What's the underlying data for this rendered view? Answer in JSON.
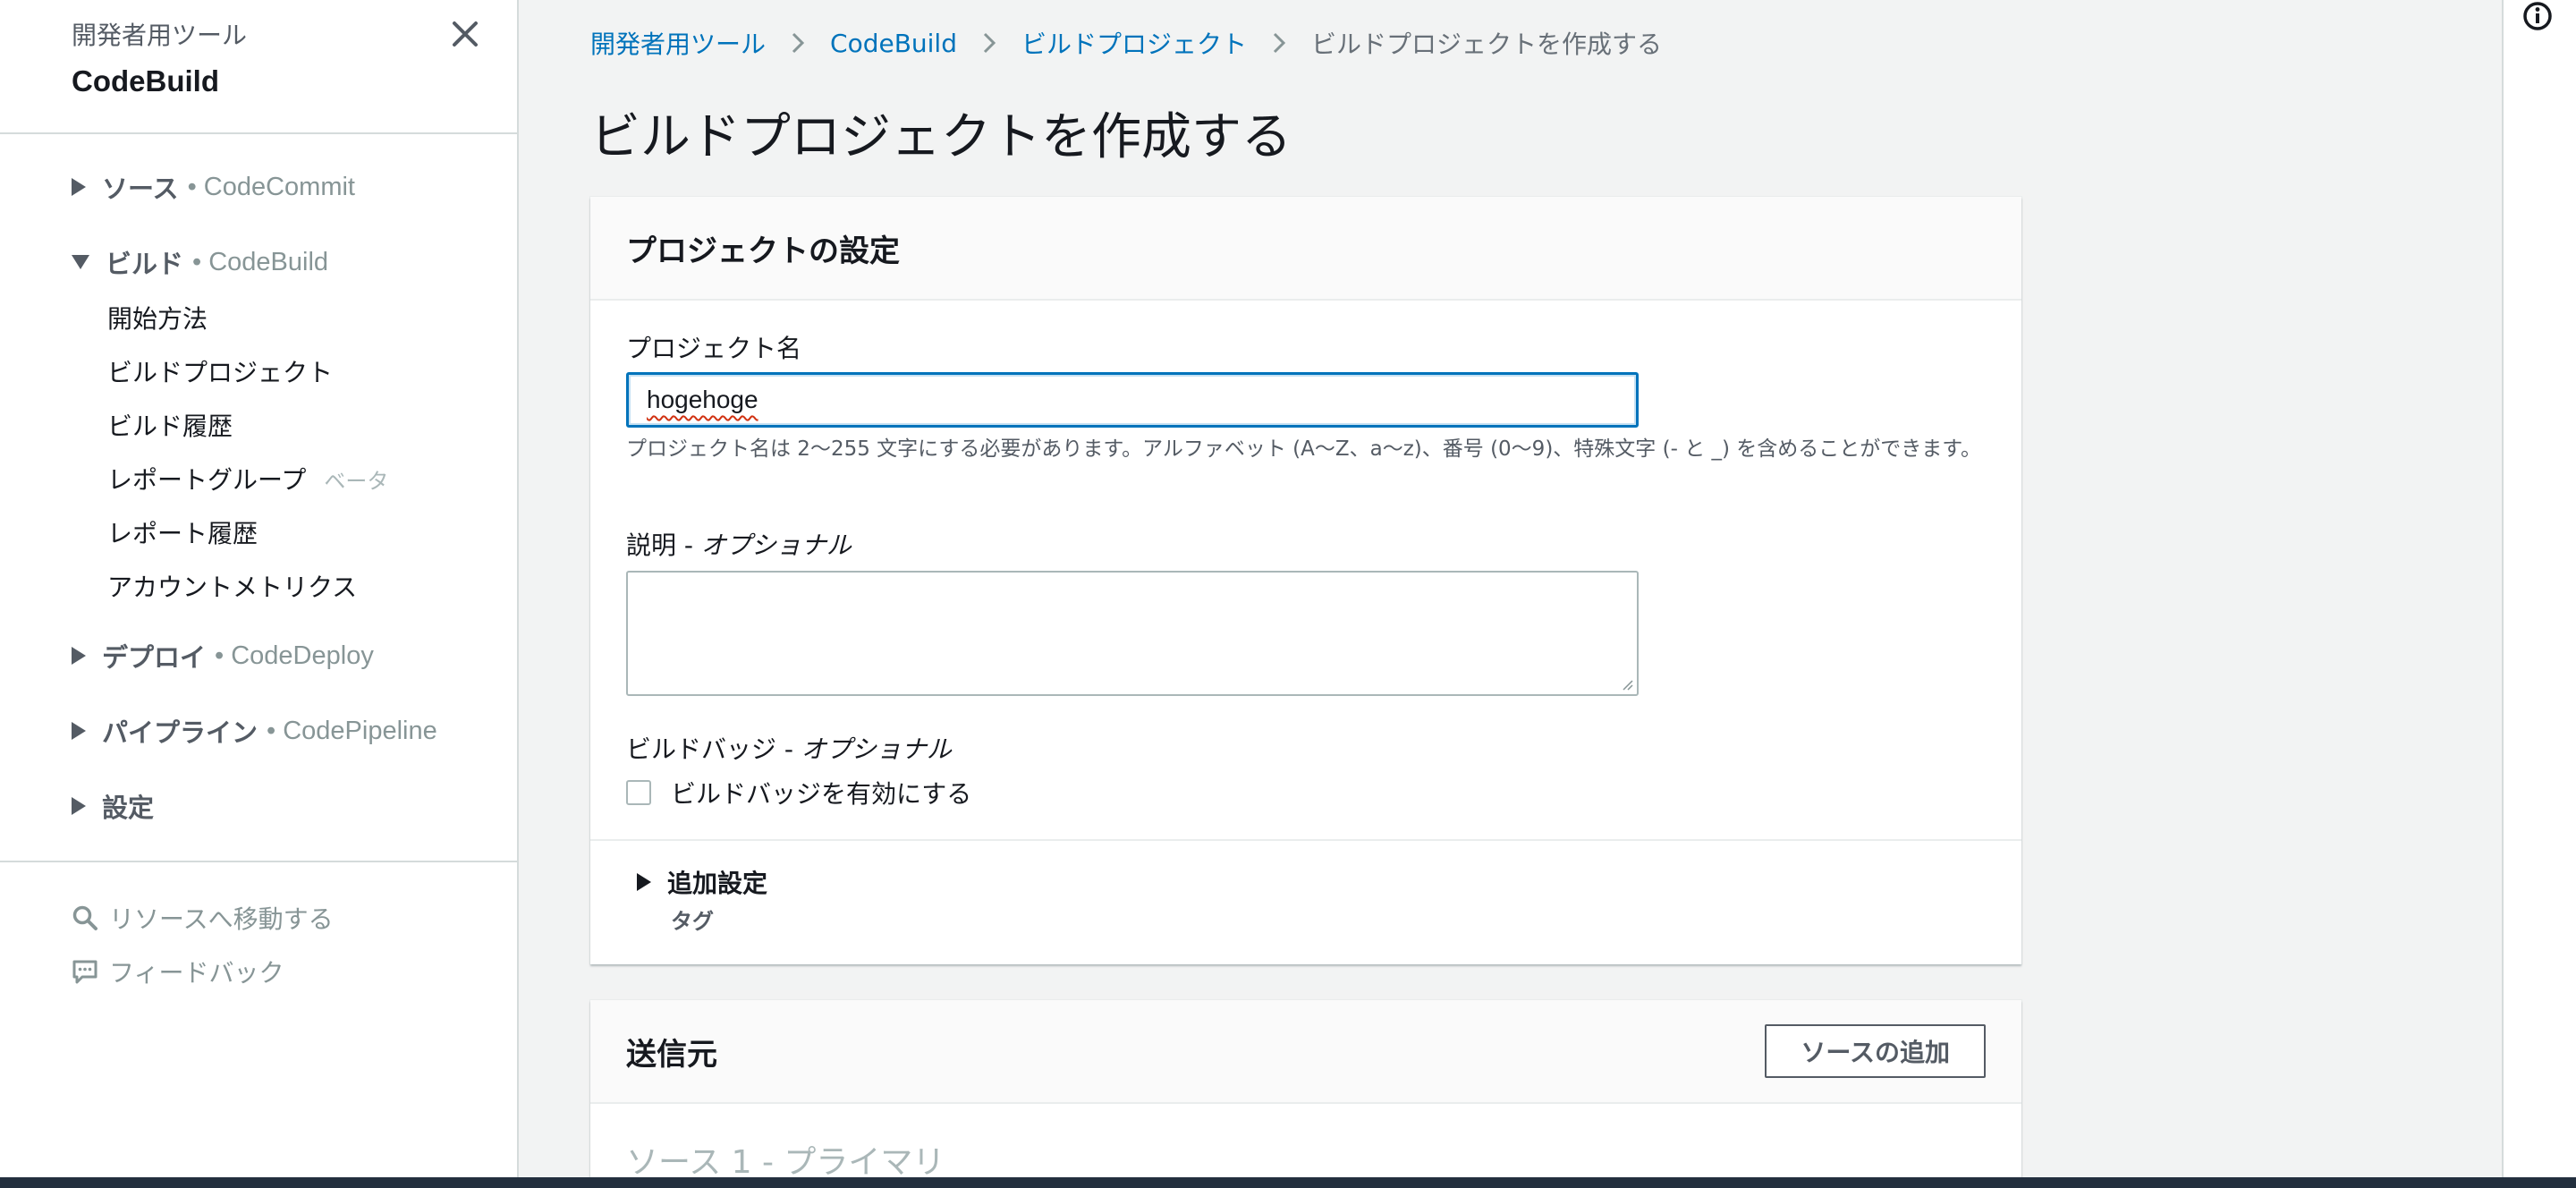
{
  "sidebar": {
    "kicker": "開発者用ツール",
    "title": "CodeBuild",
    "sections": [
      {
        "label": "ソース",
        "sub": "• CodeCommit",
        "expanded": false
      },
      {
        "label": "ビルド",
        "sub": "• CodeBuild",
        "expanded": true
      },
      {
        "label": "デプロイ",
        "sub": "• CodeDeploy",
        "expanded": false
      },
      {
        "label": "パイプライン",
        "sub": "• CodePipeline",
        "expanded": false
      },
      {
        "label": "設定",
        "sub": "",
        "expanded": false
      }
    ],
    "build_items": [
      {
        "label": "開始方法"
      },
      {
        "label": "ビルドプロジェクト"
      },
      {
        "label": "ビルド履歴"
      },
      {
        "label": "レポートグループ",
        "badge": "ベータ"
      },
      {
        "label": "レポート履歴"
      },
      {
        "label": "アカウントメトリクス"
      }
    ],
    "utilities": [
      {
        "label": "リソースへ移動する",
        "icon": "search-icon"
      },
      {
        "label": "フィードバック",
        "icon": "feedback-icon"
      }
    ]
  },
  "breadcrumb": [
    "開発者用ツール",
    "CodeBuild",
    "ビルドプロジェクト",
    "ビルドプロジェクトを作成する"
  ],
  "page_title": "ビルドプロジェクトを作成する",
  "project_settings": {
    "title": "プロジェクトの設定",
    "name_label": "プロジェクト名",
    "name_value": "hogehoge",
    "name_hint": "プロジェクト名は 2〜255 文字にする必要があります。アルファベット (A〜Z、a〜z)、番号 (0〜9)、特殊文字 (- と _) を含めることができます。",
    "description_label": "説明",
    "description_optional": "オプショナル",
    "description_value": "",
    "badge_label": "ビルドバッジ",
    "badge_optional": "オプショナル",
    "badge_checkbox_label": "ビルドバッジを有効にする",
    "badge_checked": false,
    "additional_settings_label": "追加設定",
    "additional_settings_sub": "タグ"
  },
  "source": {
    "title": "送信元",
    "add_source_label": "ソースの追加",
    "source1_title": "ソース 1 - プライマリ"
  },
  "colors": {
    "link": "#0073bb",
    "focus_border": "#0073bb",
    "text": "#16191f",
    "muted": "#545b64",
    "background": "#f2f3f3",
    "footer": "#232f3e"
  }
}
